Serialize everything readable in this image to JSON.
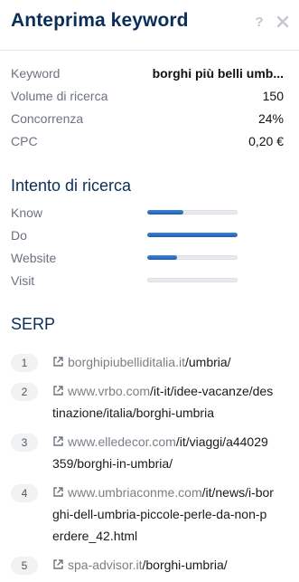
{
  "header": {
    "title": "Anteprima keyword",
    "help_icon": "question-icon",
    "close_icon": "close-icon"
  },
  "details": [
    {
      "label": "Keyword",
      "value": "borghi più belli umb..."
    },
    {
      "label": "Volume di ricerca",
      "value": "150"
    },
    {
      "label": "Concorrenza",
      "value": "24%"
    },
    {
      "label": "CPC",
      "value": "0,20 €"
    }
  ],
  "intent": {
    "title": "Intento di ricerca",
    "items": [
      {
        "label": "Know",
        "level": 0.4
      },
      {
        "label": "Do",
        "level": 1.0
      },
      {
        "label": "Website",
        "level": 0.33
      },
      {
        "label": "Visit",
        "level": 0.0
      }
    ]
  },
  "serp": {
    "title": "SERP",
    "results": [
      {
        "rank": "1",
        "host": "borghipiubelliditalia.it",
        "path": "/umbria/"
      },
      {
        "rank": "2",
        "host": "www.vrbo.com",
        "path": "/it-it/idee-vacanze/destinazione/italia/borghi-umbria"
      },
      {
        "rank": "3",
        "host": "www.elledecor.com",
        "path": "/it/viaggi/a44029359/borghi-in-umbria/"
      },
      {
        "rank": "4",
        "host": "www.umbriaconme.com",
        "path": "/it/news/i-borghi-dell-umbria-piccole-perle-da-non-perdere_42.html"
      },
      {
        "rank": "5",
        "host": "spa-advisor.it",
        "path": "/borghi-umbria/"
      }
    ]
  },
  "colors": {
    "title": "#0b2e59",
    "accent": "#1e5fb4",
    "muted": "#6b7280"
  }
}
